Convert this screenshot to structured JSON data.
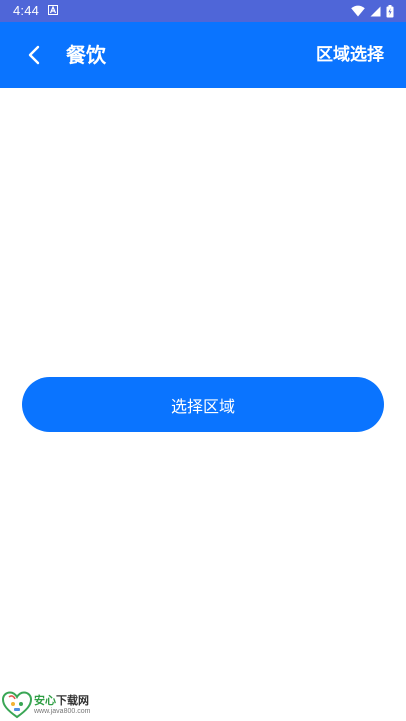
{
  "status_bar": {
    "time": "4:44",
    "icons": [
      "notification-a-icon",
      "wifi-icon",
      "signal-icon",
      "battery-icon"
    ]
  },
  "app_bar": {
    "back_icon": "chevron-left-icon",
    "title": "餐饮",
    "action_label": "区域选择"
  },
  "main": {
    "button_label": "选择区域"
  },
  "watermark": {
    "title_part1": "安心",
    "title_part2": "下载网",
    "url": "www.java800.com"
  },
  "colors": {
    "status_bar": "#4f66d8",
    "primary": "#0a74ff",
    "background": "#ffffff"
  }
}
